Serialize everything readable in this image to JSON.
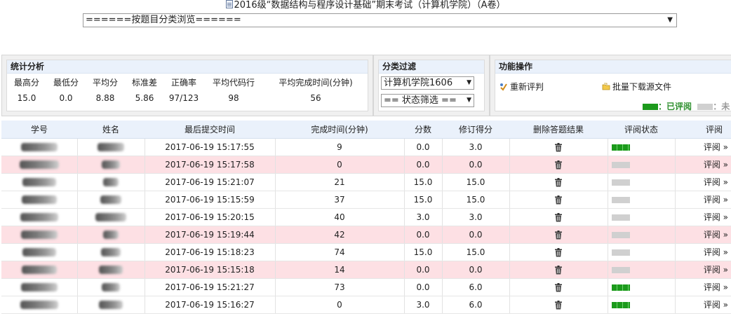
{
  "header": {
    "title": "2016级“数据结构与程序设计基础”期末考试（计算机学院）（A卷）",
    "browse_select_value": "======按题目分类浏览======"
  },
  "stats": {
    "heading": "统计分析",
    "labels": [
      "最高分",
      "最低分",
      "平均分",
      "标准差",
      "正确率",
      "平均代码行",
      "平均完成时间(分钟)"
    ],
    "values": [
      "15.0",
      "0.0",
      "8.88",
      "5.86",
      "97/123",
      "98",
      "56"
    ]
  },
  "filter": {
    "heading": "分类过滤",
    "class_value": "计算机学院1606",
    "status_value": "== 状态筛选 =="
  },
  "ops": {
    "heading": "功能操作",
    "rejudge_label": "重新评判",
    "download_label": "批量下载源文件",
    "legend_reviewed": "：已评阅",
    "legend_unreviewed": "：未",
    "reviewed_color": "#1c9a1c",
    "unreviewed_color": "#d0d0d0"
  },
  "table": {
    "headers": [
      "学号",
      "姓名",
      "最后提交时间",
      "完成时间(分钟)",
      "分数",
      "修订得分",
      "删除答题结果",
      "评阅状态",
      "评阅"
    ],
    "review_link": "评阅 »",
    "rows": [
      {
        "time": "2017-06-19 15:17:55",
        "duration": "9",
        "score": "0.0",
        "revised": "3.0",
        "reviewed": true,
        "pink": false
      },
      {
        "time": "2017-06-19 15:17:58",
        "duration": "0",
        "score": "0.0",
        "revised": "0.0",
        "reviewed": false,
        "pink": true
      },
      {
        "time": "2017-06-19 15:21:07",
        "duration": "21",
        "score": "15.0",
        "revised": "15.0",
        "reviewed": false,
        "pink": false
      },
      {
        "time": "2017-06-19 15:15:59",
        "duration": "37",
        "score": "15.0",
        "revised": "15.0",
        "reviewed": false,
        "pink": false
      },
      {
        "time": "2017-06-19 15:20:15",
        "duration": "40",
        "score": "3.0",
        "revised": "3.0",
        "reviewed": false,
        "pink": false
      },
      {
        "time": "2017-06-19 15:19:44",
        "duration": "42",
        "score": "0.0",
        "revised": "0.0",
        "reviewed": false,
        "pink": true
      },
      {
        "time": "2017-06-19 15:18:23",
        "duration": "74",
        "score": "15.0",
        "revised": "15.0",
        "reviewed": false,
        "pink": false
      },
      {
        "time": "2017-06-19 15:15:18",
        "duration": "14",
        "score": "0.0",
        "revised": "0.0",
        "reviewed": false,
        "pink": true
      },
      {
        "time": "2017-06-19 15:21:27",
        "duration": "73",
        "score": "0.0",
        "revised": "6.0",
        "reviewed": true,
        "pink": false
      },
      {
        "time": "2017-06-19 15:16:27",
        "duration": "0",
        "score": "3.0",
        "revised": "6.0",
        "reviewed": true,
        "pink": false
      }
    ]
  }
}
